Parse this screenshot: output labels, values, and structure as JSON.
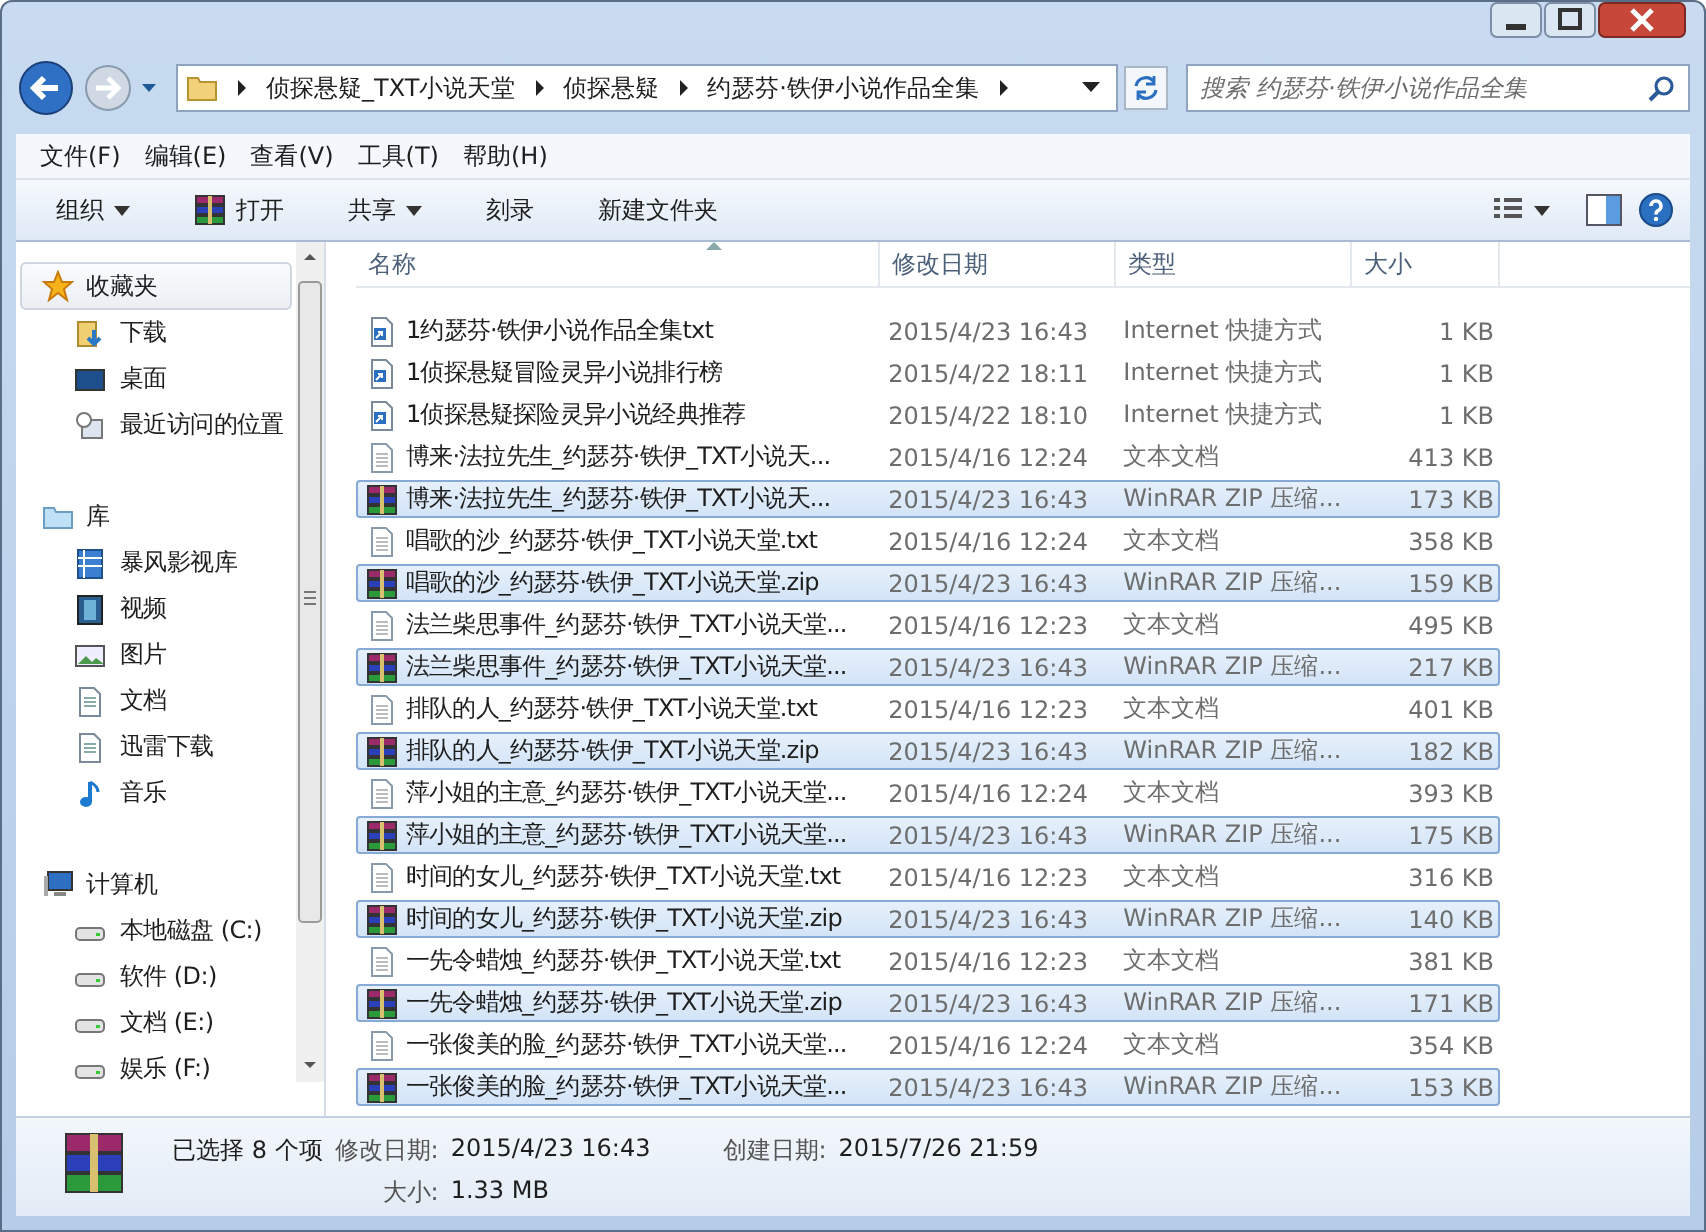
{
  "address_bar": {
    "path": [
      "侦探悬疑_TXT小说天堂",
      "侦探悬疑",
      "约瑟芬·铁伊小说作品全集"
    ],
    "search": {
      "placeholder": "搜索 约瑟芬·铁伊小说作品全集"
    }
  },
  "menu": [
    "文件(F)",
    "编辑(E)",
    "查看(V)",
    "工具(T)",
    "帮助(H)"
  ],
  "toolbar": [
    {
      "label": "组织",
      "kind": "dropdown"
    },
    {
      "label": "打开",
      "kind": "open"
    },
    {
      "label": "共享",
      "kind": "dropdown"
    },
    {
      "label": "刻录",
      "kind": "plain"
    },
    {
      "label": "新建文件夹",
      "kind": "plain"
    }
  ],
  "sidebar": [
    {
      "label": "收藏夹",
      "kind": "favorites",
      "selected": true,
      "items": [
        {
          "label": "下载",
          "kind": "download",
          "selected": false
        },
        {
          "label": "桌面",
          "kind": "desktop",
          "selected": false
        },
        {
          "label": "最近访问的位置",
          "kind": "recent",
          "selected": false
        }
      ]
    },
    {
      "label": "库",
      "kind": "library",
      "selected": false,
      "items": [
        {
          "label": "暴风影视库",
          "kind": "media",
          "selected": false
        },
        {
          "label": "视频",
          "kind": "video",
          "selected": false
        },
        {
          "label": "图片",
          "kind": "pictures",
          "selected": false
        },
        {
          "label": "文档",
          "kind": "documents",
          "selected": false
        },
        {
          "label": "迅雷下载",
          "kind": "documents",
          "selected": false
        },
        {
          "label": "音乐",
          "kind": "music",
          "selected": false
        }
      ]
    },
    {
      "label": "计算机",
      "kind": "computer",
      "selected": false,
      "items": [
        {
          "label": "本地磁盘 (C:)",
          "kind": "drive",
          "selected": false
        },
        {
          "label": "软件 (D:)",
          "kind": "drive",
          "selected": false
        },
        {
          "label": "文档 (E:)",
          "kind": "drive",
          "selected": false
        },
        {
          "label": "娱乐 (F:)",
          "kind": "drive",
          "selected": false
        }
      ]
    }
  ],
  "file_list": {
    "columns": [
      "名称",
      "修改日期",
      "类型",
      "大小"
    ],
    "rows": [
      {
        "name": "1约瑟芬·铁伊小说作品全集txt",
        "date": "2015/4/23 16:43",
        "type": "Internet 快捷方式",
        "size": "1 KB",
        "kind": "url",
        "selected": false
      },
      {
        "name": "1侦探悬疑冒险灵异小说排行榜",
        "date": "2015/4/22 18:11",
        "type": "Internet 快捷方式",
        "size": "1 KB",
        "kind": "url",
        "selected": false
      },
      {
        "name": "1侦探悬疑探险灵异小说经典推荐",
        "date": "2015/4/22 18:10",
        "type": "Internet 快捷方式",
        "size": "1 KB",
        "kind": "url",
        "selected": false
      },
      {
        "name": "博来·法拉先生_约瑟芬·铁伊_TXT小说天...",
        "date": "2015/4/16 12:24",
        "type": "文本文档",
        "size": "413 KB",
        "kind": "txt",
        "selected": false
      },
      {
        "name": "博来·法拉先生_约瑟芬·铁伊_TXT小说天...",
        "date": "2015/4/23 16:43",
        "type": "WinRAR ZIP 压缩...",
        "size": "173 KB",
        "kind": "zip",
        "selected": true
      },
      {
        "name": "唱歌的沙_约瑟芬·铁伊_TXT小说天堂.txt",
        "date": "2015/4/16 12:24",
        "type": "文本文档",
        "size": "358 KB",
        "kind": "txt",
        "selected": false
      },
      {
        "name": "唱歌的沙_约瑟芬·铁伊_TXT小说天堂.zip",
        "date": "2015/4/23 16:43",
        "type": "WinRAR ZIP 压缩...",
        "size": "159 KB",
        "kind": "zip",
        "selected": true
      },
      {
        "name": "法兰柴思事件_约瑟芬·铁伊_TXT小说天堂...",
        "date": "2015/4/16 12:23",
        "type": "文本文档",
        "size": "495 KB",
        "kind": "txt",
        "selected": false
      },
      {
        "name": "法兰柴思事件_约瑟芬·铁伊_TXT小说天堂...",
        "date": "2015/4/23 16:43",
        "type": "WinRAR ZIP 压缩...",
        "size": "217 KB",
        "kind": "zip",
        "selected": true
      },
      {
        "name": "排队的人_约瑟芬·铁伊_TXT小说天堂.txt",
        "date": "2015/4/16 12:23",
        "type": "文本文档",
        "size": "401 KB",
        "kind": "txt",
        "selected": false
      },
      {
        "name": "排队的人_约瑟芬·铁伊_TXT小说天堂.zip",
        "date": "2015/4/23 16:43",
        "type": "WinRAR ZIP 压缩...",
        "size": "182 KB",
        "kind": "zip",
        "selected": true
      },
      {
        "name": "萍小姐的主意_约瑟芬·铁伊_TXT小说天堂...",
        "date": "2015/4/16 12:24",
        "type": "文本文档",
        "size": "393 KB",
        "kind": "txt",
        "selected": false
      },
      {
        "name": "萍小姐的主意_约瑟芬·铁伊_TXT小说天堂...",
        "date": "2015/4/23 16:43",
        "type": "WinRAR ZIP 压缩...",
        "size": "175 KB",
        "kind": "zip",
        "selected": true
      },
      {
        "name": "时间的女儿_约瑟芬·铁伊_TXT小说天堂.txt",
        "date": "2015/4/16 12:23",
        "type": "文本文档",
        "size": "316 KB",
        "kind": "txt",
        "selected": false
      },
      {
        "name": "时间的女儿_约瑟芬·铁伊_TXT小说天堂.zip",
        "date": "2015/4/23 16:43",
        "type": "WinRAR ZIP 压缩...",
        "size": "140 KB",
        "kind": "zip",
        "selected": true
      },
      {
        "name": "一先令蜡烛_约瑟芬·铁伊_TXT小说天堂.txt",
        "date": "2015/4/16 12:23",
        "type": "文本文档",
        "size": "381 KB",
        "kind": "txt",
        "selected": false
      },
      {
        "name": "一先令蜡烛_约瑟芬·铁伊_TXT小说天堂.zip",
        "date": "2015/4/23 16:43",
        "type": "WinRAR ZIP 压缩...",
        "size": "171 KB",
        "kind": "zip",
        "selected": true
      },
      {
        "name": "一张俊美的脸_约瑟芬·铁伊_TXT小说天堂...",
        "date": "2015/4/16 12:24",
        "type": "文本文档",
        "size": "354 KB",
        "kind": "txt",
        "selected": false
      },
      {
        "name": "一张俊美的脸_约瑟芬·铁伊_TXT小说天堂...",
        "date": "2015/4/23 16:43",
        "type": "WinRAR ZIP 压缩...",
        "size": "153 KB",
        "kind": "zip",
        "selected": true
      }
    ]
  },
  "status_bar": {
    "selection": "已选择 8 个项",
    "modified_label": "修改日期:",
    "modified": "2015/4/23 16:43",
    "created_label": "创建日期:",
    "created": "2015/7/26 21:59",
    "size_label": "大小:",
    "size": "1.33 MB"
  }
}
